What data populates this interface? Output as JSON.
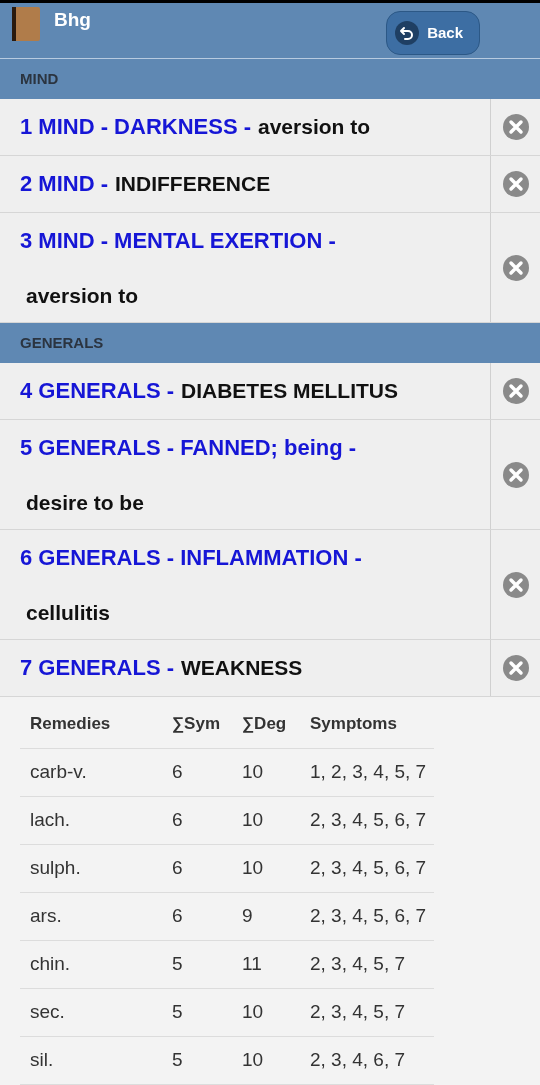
{
  "header": {
    "title": "Bhg",
    "back_button": "Back"
  },
  "sections": [
    {
      "title": "MIND",
      "items": [
        {
          "kind": "inline",
          "path": "1 MIND - DARKNESS -",
          "rest": "aversion to"
        },
        {
          "kind": "inline",
          "path": "2 MIND -",
          "rest": "INDIFFERENCE"
        },
        {
          "kind": "block",
          "path": "3 MIND - MENTAL EXERTION -",
          "rest": "aversion to"
        }
      ]
    },
    {
      "title": "GENERALS",
      "items": [
        {
          "kind": "inline",
          "path": "4 GENERALS -",
          "rest": "DIABETES MELLITUS"
        },
        {
          "kind": "block",
          "path": "5 GENERALS - FANNED; being -",
          "rest": "desire to be"
        },
        {
          "kind": "block",
          "path": "6 GENERALS - INFLAMMATION -",
          "rest": "cellulitis"
        },
        {
          "kind": "inline",
          "path": "7 GENERALS -",
          "rest": "WEAKNESS"
        }
      ]
    }
  ],
  "table": {
    "columns": [
      "Remedies",
      "∑Sym",
      "∑Deg",
      "Symptoms"
    ],
    "rows": [
      [
        "carb-v.",
        "6",
        "10",
        "1, 2, 3, 4, 5, 7"
      ],
      [
        "lach.",
        "6",
        "10",
        "2, 3, 4, 5, 6, 7"
      ],
      [
        "sulph.",
        "6",
        "10",
        "2, 3, 4, 5, 6, 7"
      ],
      [
        "ars.",
        "6",
        "9",
        "2, 3, 4, 5, 6, 7"
      ],
      [
        "chin.",
        "5",
        "11",
        "2, 3, 4, 5, 7"
      ],
      [
        "sec.",
        "5",
        "10",
        "2, 3, 4, 5, 7"
      ],
      [
        "sil.",
        "5",
        "10",
        "2, 3, 4, 6, 7"
      ]
    ]
  }
}
